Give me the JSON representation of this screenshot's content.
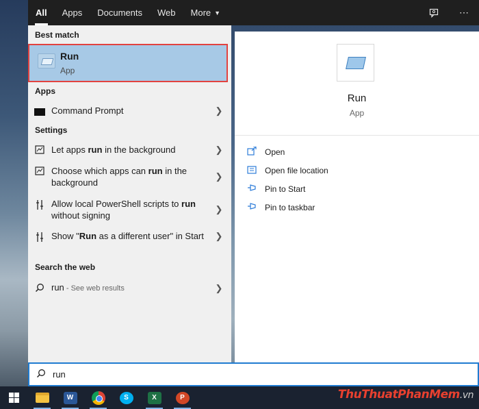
{
  "header": {
    "tabs": [
      {
        "label": "All",
        "active": true
      },
      {
        "label": "Apps"
      },
      {
        "label": "Documents"
      },
      {
        "label": "Web"
      },
      {
        "label": "More"
      }
    ],
    "icons": [
      "feedback-icon",
      "more-options-icon"
    ]
  },
  "left": {
    "best_match_header": "Best match",
    "best_match": {
      "name": "Run",
      "type": "App",
      "icon": "run-app-icon"
    },
    "apps_header": "Apps",
    "apps": [
      {
        "label": "Command Prompt",
        "icon": "command-prompt-icon"
      }
    ],
    "settings_header": "Settings",
    "settings": [
      {
        "pre": "Let apps ",
        "bold": "run",
        "post": " in the background",
        "icon": "settings-page-icon"
      },
      {
        "pre": "Choose which apps can ",
        "bold": "run",
        "post": " in the background",
        "icon": "settings-page-icon"
      },
      {
        "pre": "Allow local PowerShell scripts to ",
        "bold": "run",
        "post": " without signing",
        "icon": "settings-toolbar-icon"
      },
      {
        "pre": "Show \"",
        "bold": "Run",
        "post": " as a different user\" in Start",
        "icon": "settings-toolbar-icon"
      }
    ],
    "web_header": "Search the web",
    "web": {
      "query": "run",
      "sub": " - See web results",
      "icon": "search-icon"
    }
  },
  "right": {
    "name": "Run",
    "type": "App",
    "actions": [
      {
        "label": "Open",
        "icon": "open-icon"
      },
      {
        "label": "Open file location",
        "icon": "folder-location-icon"
      },
      {
        "label": "Pin to Start",
        "icon": "pin-icon"
      },
      {
        "label": "Pin to taskbar",
        "icon": "pin-icon"
      }
    ]
  },
  "search": {
    "value": "run"
  },
  "taskbar": {
    "items": [
      "windows-start-icon",
      "file-explorer-icon",
      "word-icon",
      "chrome-icon",
      "skype-icon",
      "excel-icon",
      "powerpoint-icon"
    ],
    "word_letter": "W",
    "excel_letter": "X",
    "skype_letter": "S",
    "ppt_letter": "P"
  },
  "watermark": {
    "part1": "ThuThuat",
    "part2": "PhanMem",
    "part3": ".vn"
  },
  "colors": {
    "accent": "#1f7bd0",
    "highlight": "#a7c9e6",
    "highlight_border": "#e2423f"
  }
}
